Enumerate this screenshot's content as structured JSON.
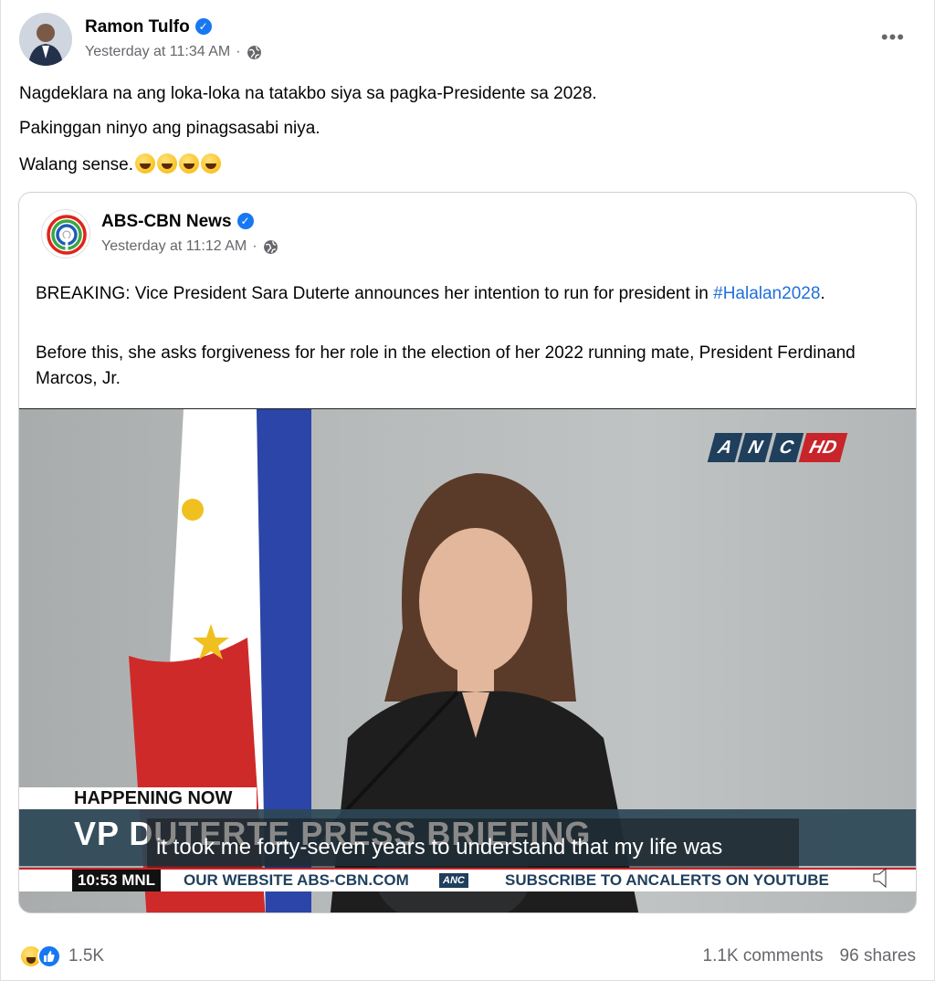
{
  "post": {
    "author": "Ramon Tulfo",
    "timestamp": "Yesterday at 11:34 AM",
    "separator": "·",
    "more_label": "•••",
    "lines": [
      "Nagdeklara na ang loka-loka na tatakbo siya sa pagka-Presidente sa 2028.",
      "Pakinggan ninyo ang pinagsasabi niya.",
      "Walang sense."
    ],
    "emojis": [
      "rolling-on-floor-laughing",
      "face-with-tears-of-joy",
      "grinning-squinting-face",
      "grinning-face"
    ]
  },
  "shared": {
    "source": "ABS-CBN News",
    "timestamp": "Yesterday at 11:12 AM",
    "separator": "·",
    "para1_main": "BREAKING: Vice President Sara Duterte announces her intention to run for president in",
    "para1_hashtag": "#Halalan2028",
    "para1_end": ".",
    "para2": "Before this, she asks forgiveness for her role in the election of her 2022 running mate, President Ferdinand Marcos, Jr."
  },
  "video": {
    "logo_parts": [
      "A",
      "N",
      "C",
      "HD"
    ],
    "happening": "HAPPENING NOW",
    "title": "VP DUTERTE PRESS BRIEFING",
    "subtitle": "it took me forty-seven years to understand that my life was",
    "clock": "10:53",
    "clock_zone": "MNL",
    "ticker_left": "OUR WEBSITE ABS-CBN.COM",
    "ticker_anc": "ANC",
    "ticker_right": "SUBSCRIBE TO ANCALERTS ON YOUTUBE"
  },
  "footer": {
    "reaction_count": "1.5K",
    "comments": "1.1K comments",
    "shares": "96 shares"
  },
  "colors": {
    "verified": "#1877f2",
    "hashtag": "#216fdb",
    "anc_blue": "#1f3f5c",
    "anc_red": "#c8242b",
    "muted_text": "#65676b"
  }
}
